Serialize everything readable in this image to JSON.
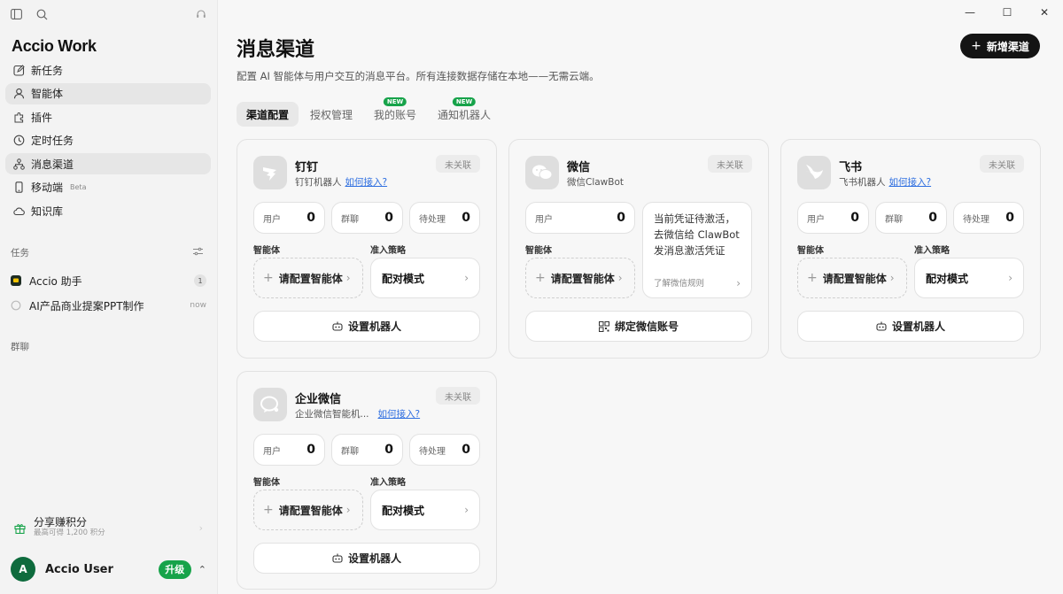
{
  "sidebar": {
    "brand": "Accio Work",
    "nav": [
      {
        "label": "新任务",
        "icon": "edit-icon"
      },
      {
        "label": "智能体",
        "icon": "user-icon"
      },
      {
        "label": "插件",
        "icon": "puzzle-icon"
      },
      {
        "label": "定时任务",
        "icon": "clock-icon"
      },
      {
        "label": "消息渠道",
        "icon": "channels-icon"
      },
      {
        "label": "移动端",
        "icon": "mobile-icon",
        "badge": "Beta"
      },
      {
        "label": "知识库",
        "icon": "cloud-icon"
      }
    ],
    "tasks_title": "任务",
    "tasks": [
      {
        "label": "Accio 助手",
        "count": "1"
      },
      {
        "label": "AI产品商业提案PPT制作",
        "time": "now"
      }
    ],
    "group_title": "群聊",
    "share": {
      "title": "分享赚积分",
      "subtitle": "最高可得 1,200 积分"
    },
    "user": {
      "initial": "A",
      "name": "Accio User",
      "upgrade": "升级"
    }
  },
  "window_controls": {
    "minimize": "—",
    "maximize": "☐",
    "close": "✕"
  },
  "page": {
    "title": "消息渠道",
    "subtitle": "配置 AI 智能体与用户交互的消息平台。所有连接数据存储在本地——无需云端。",
    "new_button": "新增渠道",
    "new_tag": "NEW"
  },
  "tabs": [
    "渠道配置",
    "授权管理",
    "我的账号",
    "通知机器人"
  ],
  "labels": {
    "users": "用户",
    "groups": "群聊",
    "pending": "待处理",
    "agent": "智能体",
    "policy": "准入策略",
    "agent_value": "请配置智能体",
    "policy_value": "配对模式",
    "how_to": "如何接入?",
    "status": "未关联",
    "set_bot": "设置机器人"
  },
  "channels": {
    "dingtalk": {
      "name": "钉钉",
      "desc": "钉钉机器人",
      "users": "0",
      "groups": "0",
      "pending": "0"
    },
    "wechat": {
      "name": "微信",
      "desc": "微信ClawBot",
      "users": "0",
      "note": "当前凭证待激活，去微信给 ClawBot 发消息激活凭证",
      "note_link": "了解微信规则",
      "action": "绑定微信账号"
    },
    "feishu": {
      "name": "飞书",
      "desc": "飞书机器人",
      "users": "0",
      "groups": "0",
      "pending": "0"
    },
    "wecom": {
      "name": "企业微信",
      "desc": "企业微信智能机...",
      "users": "0",
      "groups": "0",
      "pending": "0"
    }
  }
}
